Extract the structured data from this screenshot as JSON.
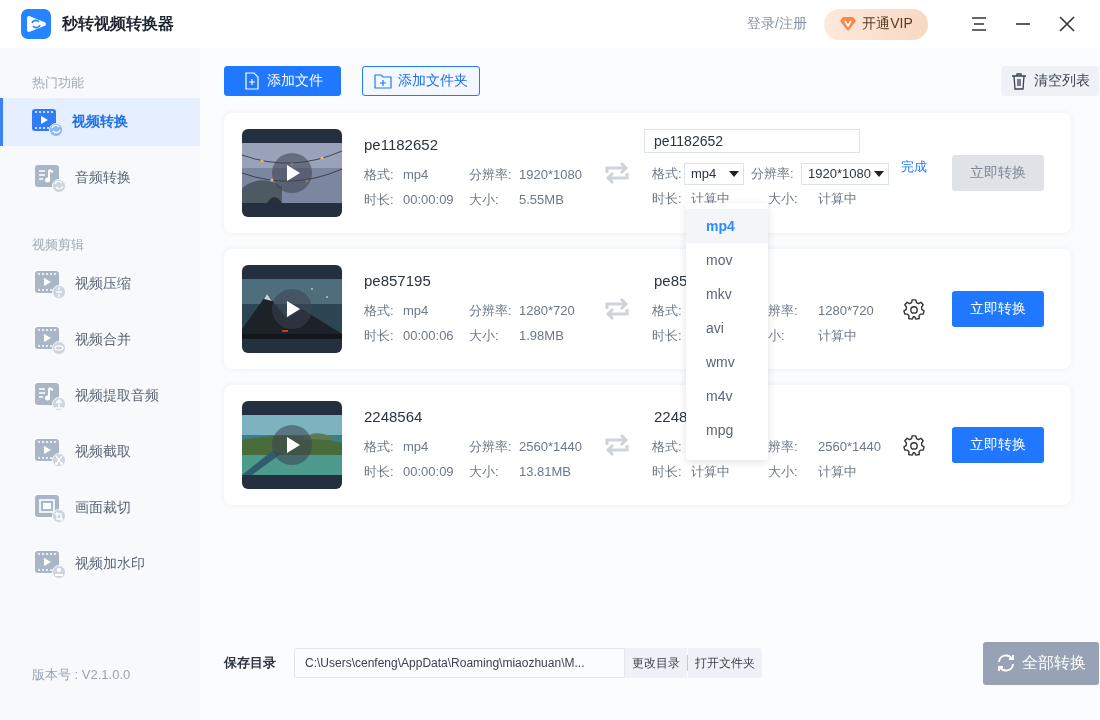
{
  "app": {
    "title": "秒转视频转换器"
  },
  "header": {
    "login": "登录/注册",
    "vip": "开通VIP"
  },
  "sidebar": {
    "sections": [
      {
        "title": "热门功能",
        "items": [
          {
            "label": "视频转换",
            "selected": true
          },
          {
            "label": "音频转换",
            "selected": false
          }
        ]
      },
      {
        "title": "视频剪辑",
        "items": [
          {
            "label": "视频压缩",
            "selected": false
          },
          {
            "label": "视频合并",
            "selected": false
          },
          {
            "label": "视频提取音频",
            "selected": false
          },
          {
            "label": "视频截取",
            "selected": false
          },
          {
            "label": "画面裁切",
            "selected": false
          },
          {
            "label": "视频加水印",
            "selected": false
          }
        ]
      }
    ],
    "version": "版本号 : V2.1.0.0"
  },
  "toolbar": {
    "add_file": "添加文件",
    "add_folder": "添加文件夹",
    "clear": "清空列表"
  },
  "files": [
    {
      "name": "pe1182652",
      "format_label": "格式:",
      "format": "mp4",
      "resolution_label": "分辨率:",
      "resolution": "1920*1080",
      "duration_label": "时长:",
      "duration": "00:00:09",
      "size_label": "大小:",
      "size": "5.55MB",
      "output": {
        "kind": "editing",
        "name": "pe1182652",
        "format_label": "格式:",
        "format": "mp4",
        "resolution_label": "分辨率:",
        "resolution": "1920*1080",
        "duration_label": "时长:",
        "duration": "计算中",
        "size_label": "大小:",
        "size": "计算中",
        "format_menu": [
          {
            "label": "mp4",
            "selected": true
          },
          {
            "label": "mov",
            "selected": false
          },
          {
            "label": "mkv",
            "selected": false
          },
          {
            "label": "avi",
            "selected": false
          },
          {
            "label": "wmv",
            "selected": false
          },
          {
            "label": "m4v",
            "selected": false
          },
          {
            "label": "mpg",
            "selected": false
          }
        ]
      },
      "action": {
        "kind": "link",
        "label": "完成"
      },
      "convert": {
        "label": "立即转换",
        "disabled": true
      }
    },
    {
      "name": "pe857195",
      "format_label": "格式:",
      "format": "mp4",
      "resolution_label": "分辨率:",
      "resolution": "1280*720",
      "duration_label": "时长:",
      "duration": "00:00:06",
      "size_label": "大小:",
      "size": "1.98MB",
      "output": {
        "kind": "plain",
        "name": "pe85",
        "format_label": "格式:",
        "resolution_label": "辨率:",
        "resolution": "1280*720",
        "duration_label": "时长:",
        "size_label": "小:",
        "size": "计算中"
      },
      "action": {
        "kind": "settings"
      },
      "convert": {
        "label": "立即转换",
        "disabled": false
      }
    },
    {
      "name": "2248564",
      "format_label": "格式:",
      "format": "mp4",
      "resolution_label": "分辨率:",
      "resolution": "2560*1440",
      "duration_label": "时长:",
      "duration": "00:00:09",
      "size_label": "大小:",
      "size": "13.81MB",
      "output": {
        "kind": "plain",
        "name": "2248",
        "format_label": "格式:",
        "resolution_label": "辨率:",
        "resolution": "2560*1440",
        "duration_label": "时长:",
        "duration": "计算中",
        "size_label": "大小:",
        "size": "计算中"
      },
      "action": {
        "kind": "settings"
      },
      "convert": {
        "label": "立即转换",
        "disabled": false
      }
    }
  ],
  "footer": {
    "save_label": "保存目录",
    "path": "C:\\Users\\cenfeng\\AppData\\Roaming\\miaozhuan\\M...",
    "change": "更改目录",
    "open": "打开文件夹",
    "convert_all": {
      "label": "全部转换",
      "disabled": true
    }
  }
}
